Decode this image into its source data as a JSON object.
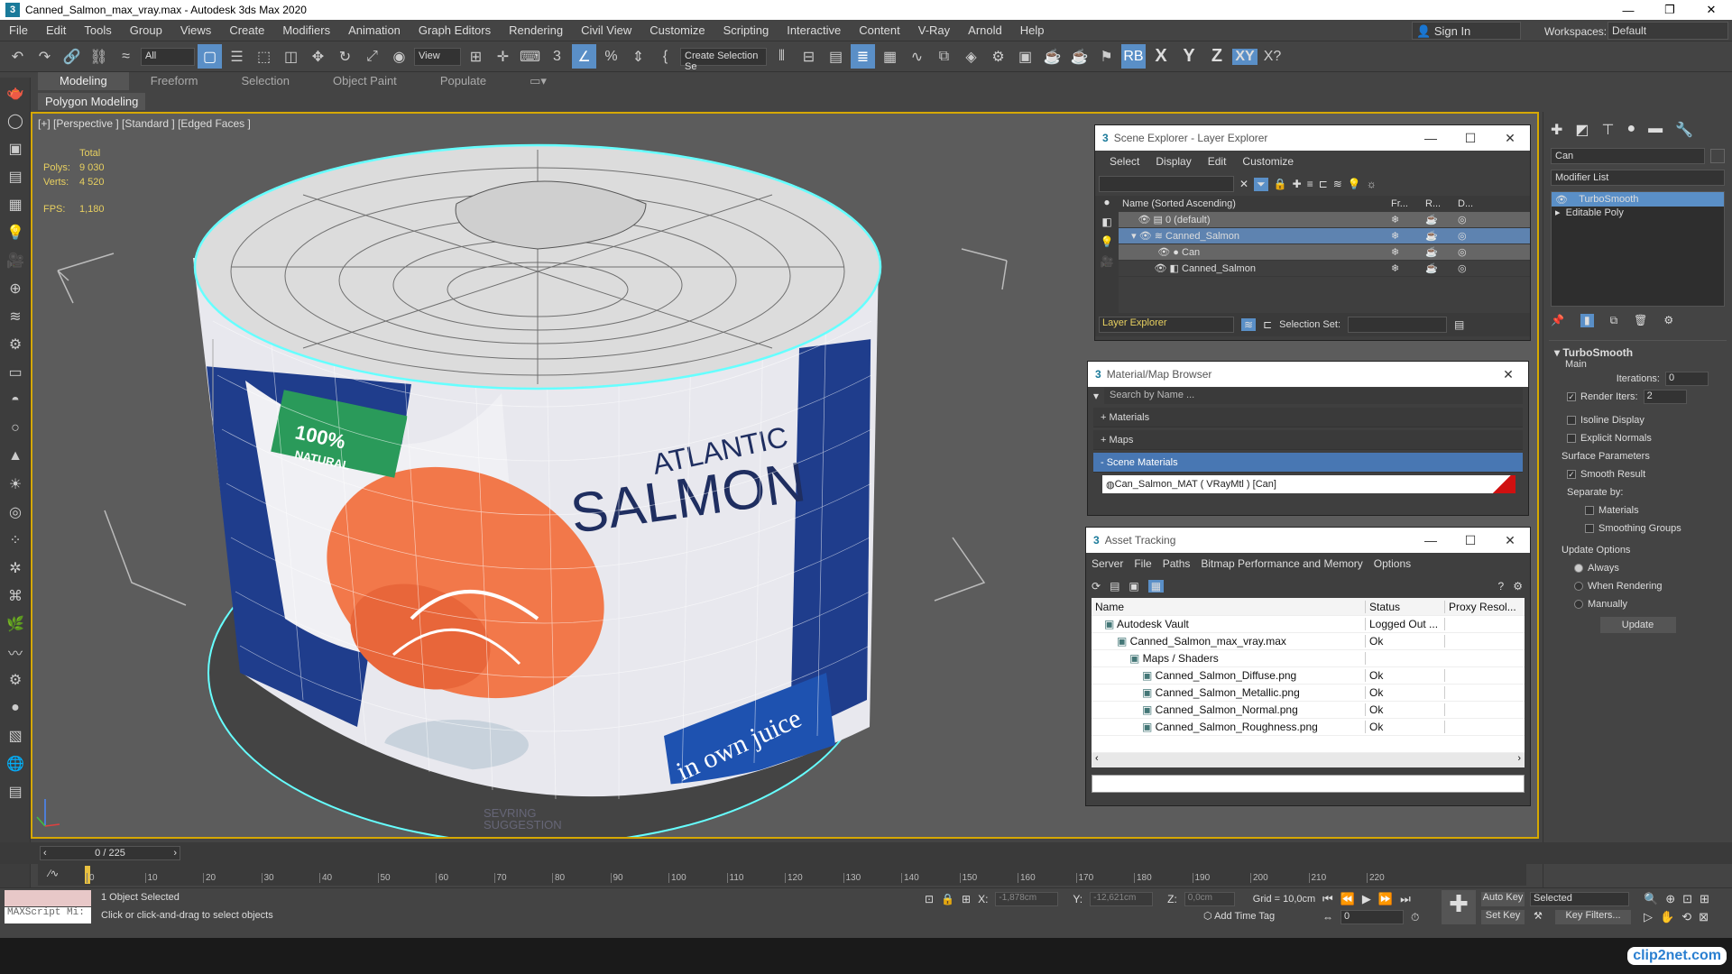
{
  "window": {
    "title": "Canned_Salmon_max_vray.max - Autodesk 3ds Max 2020"
  },
  "menu": [
    "File",
    "Edit",
    "Tools",
    "Group",
    "Views",
    "Create",
    "Modifiers",
    "Animation",
    "Graph Editors",
    "Rendering",
    "Civil View",
    "Customize",
    "Scripting",
    "Interactive",
    "Content",
    "V-Ray",
    "Arnold",
    "Help"
  ],
  "account": {
    "sign_in": "Sign In",
    "workspaces_label": "Workspaces:",
    "workspace": "Default"
  },
  "toolbar": {
    "filter": "All",
    "refcoord": "View",
    "selection_set": "Create Selection Se",
    "axes": [
      "X",
      "Y",
      "Z",
      "XY"
    ]
  },
  "ribbon": {
    "tabs": [
      "Modeling",
      "Freeform",
      "Selection",
      "Object Paint",
      "Populate"
    ],
    "sub": "Polygon Modeling"
  },
  "viewport": {
    "label": "[+] [Perspective ] [Standard ] [Edged Faces ]",
    "stats": {
      "total": "Total",
      "polys_label": "Polys:",
      "polys": "9 030",
      "verts_label": "Verts:",
      "verts": "4 520",
      "fps_label": "FPS:",
      "fps": "1,180"
    },
    "can_text": {
      "brand1": "ATLANTIC",
      "brand2": "SALMON",
      "badge": "100%",
      "badge2": "NATURAL",
      "ribbon": "in own juice",
      "serving": "SEVRING",
      "serving2": "SUGGESTION"
    }
  },
  "scene_explorer": {
    "title": "Scene Explorer - Layer Explorer",
    "menu": [
      "Select",
      "Display",
      "Edit",
      "Customize"
    ],
    "columns": {
      "name": "Name (Sorted Ascending)",
      "c2": "Fr...",
      "c3": "R...",
      "c4": "D..."
    },
    "rows": [
      "0 (default)",
      "Canned_Salmon",
      "Can",
      "Canned_Salmon"
    ],
    "footer_mode": "Layer Explorer",
    "selection_set_label": "Selection Set:"
  },
  "material_browser": {
    "title": "Material/Map Browser",
    "search_placeholder": "Search by Name ...",
    "groups": [
      "+ Materials",
      "+ Maps",
      "- Scene Materials"
    ],
    "material": "Can_Salmon_MAT  ( VRayMtl ) [Can]"
  },
  "asset_tracking": {
    "title": "Asset Tracking",
    "menu": [
      "Server",
      "File",
      "Paths",
      "Bitmap Performance and Memory",
      "Options"
    ],
    "columns": [
      "Name",
      "Status",
      "Proxy Resol..."
    ],
    "rows": [
      {
        "name": "Autodesk Vault",
        "status": "Logged Out ...",
        "indent": 1
      },
      {
        "name": "Canned_Salmon_max_vray.max",
        "status": "Ok",
        "indent": 2
      },
      {
        "name": "Maps / Shaders",
        "status": "",
        "indent": 3
      },
      {
        "name": "Canned_Salmon_Diffuse.png",
        "status": "Ok",
        "indent": 4
      },
      {
        "name": "Canned_Salmon_Metallic.png",
        "status": "Ok",
        "indent": 4
      },
      {
        "name": "Canned_Salmon_Normal.png",
        "status": "Ok",
        "indent": 4
      },
      {
        "name": "Canned_Salmon_Roughness.png",
        "status": "Ok",
        "indent": 4
      }
    ]
  },
  "command_panel": {
    "object_name": "Can",
    "modifier_list": "Modifier List",
    "stack": [
      "TurboSmooth",
      "Editable Poly"
    ],
    "rollout_title": "TurboSmooth",
    "main_label": "Main",
    "iterations_label": "Iterations:",
    "iterations": "0",
    "render_iters_label": "Render Iters:",
    "render_iters": "2",
    "isoline": "Isoline Display",
    "explicit": "Explicit Normals",
    "surface_params": "Surface Parameters",
    "smooth_result": "Smooth Result",
    "separate_by": "Separate by:",
    "materials": "Materials",
    "smoothing_groups": "Smoothing Groups",
    "update_options": "Update Options",
    "always": "Always",
    "when_rendering": "When Rendering",
    "manually": "Manually",
    "update_btn": "Update"
  },
  "timeline": {
    "frame": "0 / 225",
    "ticks": [
      "0",
      "10",
      "20",
      "30",
      "40",
      "50",
      "60",
      "70",
      "80",
      "90",
      "100",
      "110",
      "120",
      "130",
      "140",
      "150",
      "160",
      "170",
      "180",
      "190",
      "200",
      "210",
      "220"
    ]
  },
  "status": {
    "maxscript": "MAXScript Mi:",
    "selected": "1 Object Selected",
    "prompt": "Click or click-and-drag to select objects",
    "x": "-1,878cm",
    "y": "-12,621cm",
    "z": "0,0cm",
    "grid": "Grid = 10,0cm",
    "add_time_tag": "Add Time Tag",
    "auto_key": "Auto Key",
    "set_key": "Set Key",
    "key_mode": "Selected",
    "key_filters": "Key Filters...",
    "frame_field": "0"
  },
  "watermark": "clip2net.com"
}
